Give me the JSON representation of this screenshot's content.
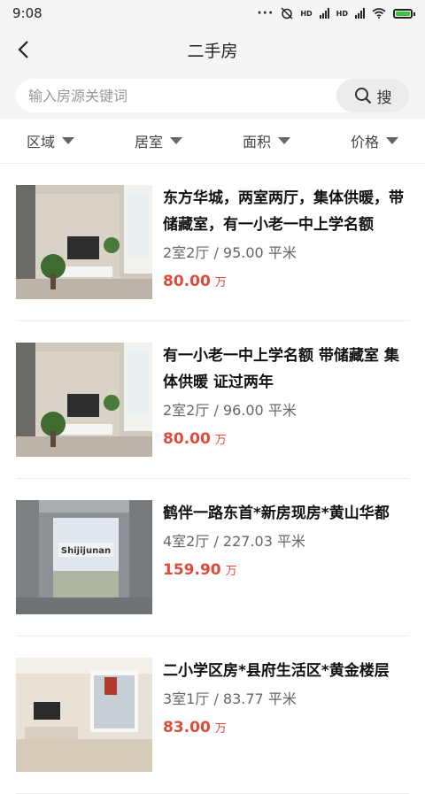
{
  "status": {
    "time": "9:08",
    "signal1": "HD",
    "signal2": "HD"
  },
  "header": {
    "title": "二手房"
  },
  "search": {
    "placeholder": "输入房源关键词",
    "button_label": "搜"
  },
  "filters": [
    {
      "label": "区域"
    },
    {
      "label": "居室"
    },
    {
      "label": "面积"
    },
    {
      "label": "价格"
    }
  ],
  "listings": [
    {
      "title": "东方华城，两室两厅，集体供暖，带储藏室，有一小老一中上学名额",
      "meta": "2室2厅 / 95.00 平米",
      "price": "80.00",
      "unit": "万",
      "photo": "living-room-photo"
    },
    {
      "title": "有一小老一中上学名额 带储藏室 集体供暖 证过两年",
      "meta": "2室2厅 / 96.00 平米",
      "price": "80.00",
      "unit": "万",
      "photo": "living-room-photo"
    },
    {
      "title": "鹤伴一路东首*新房现房*黄山华都",
      "meta": "4室2厅 / 227.03 平米",
      "price": "159.90",
      "unit": "万",
      "photo": "unfinished-room-photo",
      "photo_text": "Shijijunan"
    },
    {
      "title": "二小学区房*县府生活区*黄金楼层",
      "meta": "3室1厅 / 83.77 平米",
      "price": "83.00",
      "unit": "万",
      "photo": "living-room-photo"
    }
  ]
}
